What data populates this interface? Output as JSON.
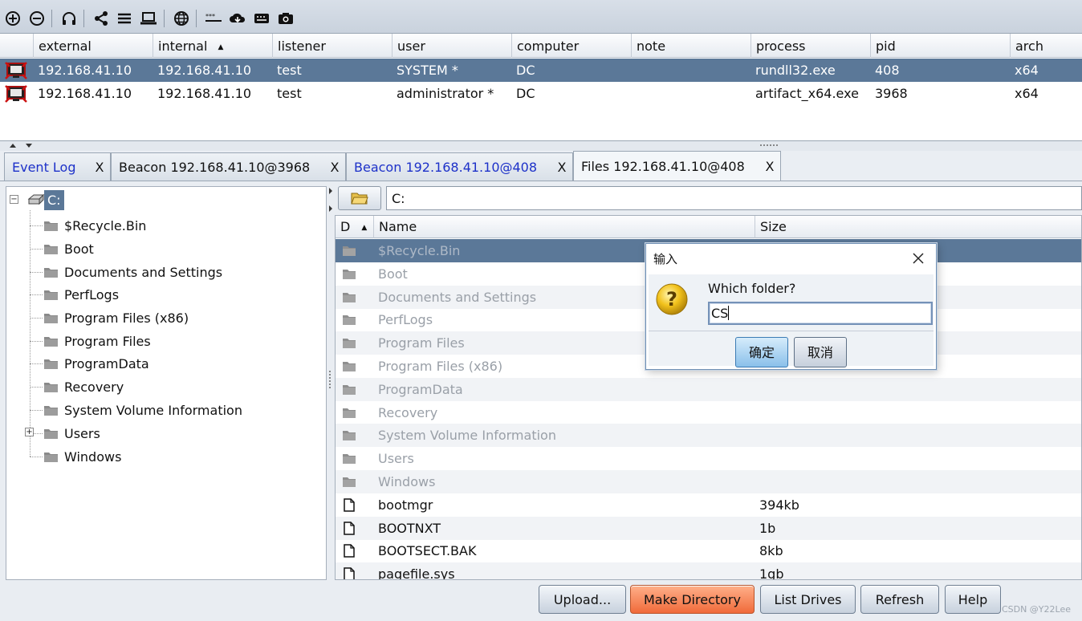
{
  "toolbar": {
    "icons": [
      "new-connection-icon",
      "disconnect-icon",
      "listeners-headset-icon",
      "pivot-graph-icon",
      "session-table-icon",
      "targets-laptop-icon",
      "web-log-icon",
      "credentials-icon",
      "downloads-cloud-icon",
      "keystrokes-keyboard-icon",
      "screenshots-camera-icon"
    ]
  },
  "sessions": {
    "columns": [
      "external",
      "internal",
      "listener",
      "user",
      "computer",
      "note",
      "process",
      "pid",
      "arch"
    ],
    "sort_column": "internal",
    "rows": [
      {
        "external": "192.168.41.10",
        "internal": "192.168.41.10",
        "listener": "test",
        "user": "SYSTEM *",
        "computer": "DC",
        "note": "",
        "process": "rundll32.exe",
        "pid": "408",
        "arch": "x64"
      },
      {
        "external": "192.168.41.10",
        "internal": "192.168.41.10",
        "listener": "test",
        "user": "administrator *",
        "computer": "DC",
        "note": "",
        "process": "artifact_x64.exe",
        "pid": "3968",
        "arch": "x64"
      }
    ]
  },
  "tabs": [
    {
      "label": "Event Log",
      "close": "X"
    },
    {
      "label": "Beacon 192.168.41.10@3968",
      "close": "X"
    },
    {
      "label": "Beacon 192.168.41.10@408",
      "close": "X"
    },
    {
      "label": "Files 192.168.41.10@408",
      "close": "X"
    }
  ],
  "tree": {
    "root": "C:",
    "items": [
      "$Recycle.Bin",
      "Boot",
      "Documents and Settings",
      "PerfLogs",
      "Program Files (x86)",
      "Program Files",
      "ProgramData",
      "Recovery",
      "System Volume Information",
      "Users",
      "Windows"
    ]
  },
  "browser": {
    "path": "C:",
    "columns": {
      "d": "D",
      "name": "Name",
      "size": "Size"
    },
    "rows": [
      {
        "name": "$Recycle.Bin",
        "size": "",
        "type": "dir"
      },
      {
        "name": "Boot",
        "size": "",
        "type": "dir"
      },
      {
        "name": "Documents and Settings",
        "size": "",
        "type": "dir"
      },
      {
        "name": "PerfLogs",
        "size": "",
        "type": "dir"
      },
      {
        "name": "Program Files",
        "size": "",
        "type": "dir"
      },
      {
        "name": "Program Files (x86)",
        "size": "",
        "type": "dir"
      },
      {
        "name": "ProgramData",
        "size": "",
        "type": "dir"
      },
      {
        "name": "Recovery",
        "size": "",
        "type": "dir"
      },
      {
        "name": "System Volume Information",
        "size": "",
        "type": "dir"
      },
      {
        "name": "Users",
        "size": "",
        "type": "dir"
      },
      {
        "name": "Windows",
        "size": "",
        "type": "dir"
      },
      {
        "name": "bootmgr",
        "size": "394kb",
        "type": "file"
      },
      {
        "name": "BOOTNXT",
        "size": "1b",
        "type": "file"
      },
      {
        "name": "BOOTSECT.BAK",
        "size": "8kb",
        "type": "file"
      },
      {
        "name": "pagefile.sys",
        "size": "1gb",
        "type": "file"
      }
    ],
    "buttons": {
      "upload": "Upload...",
      "make_directory": "Make Directory",
      "list_drives": "List Drives",
      "refresh": "Refresh",
      "help": "Help"
    }
  },
  "dialog": {
    "title": "输入",
    "prompt": "Which folder?",
    "value": "CS",
    "ok": "确定",
    "cancel": "取消"
  },
  "watermark": "CSDN @Y22Lee",
  "colors": {
    "selection": "#5b7898",
    "tab_link": "#1d31c9",
    "make_directory_button": "#f06a3a"
  }
}
